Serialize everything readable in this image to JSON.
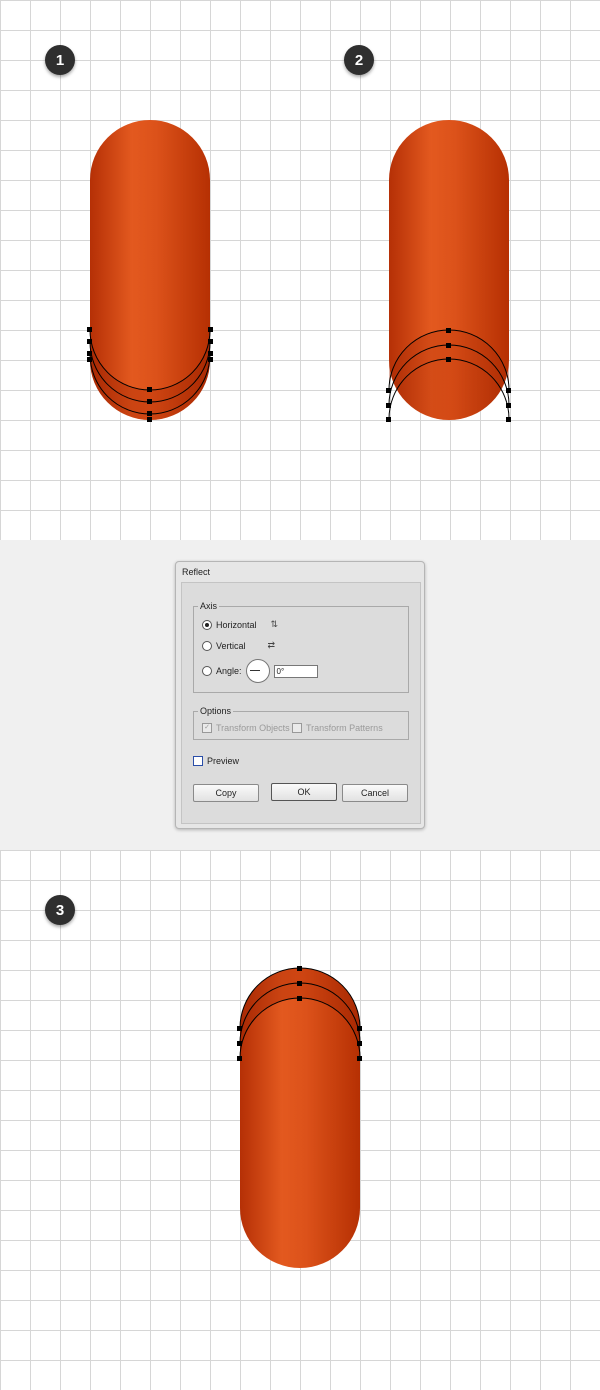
{
  "steps": {
    "s1": "1",
    "s2": "2",
    "s3": "3"
  },
  "colors": {
    "pill_dark": "#b62e03",
    "pill_light": "#e25c1f",
    "handle": "#000000",
    "step_bg": "#2f2f2f"
  },
  "dialog": {
    "title": "Reflect",
    "axis_legend": "Axis",
    "horizontal_label": "Horizontal",
    "vertical_label": "Vertical",
    "angle_label": "Angle:",
    "angle_value": "0°",
    "options_legend": "Options",
    "transform_objects_label": "Transform Objects",
    "transform_patterns_label": "Transform Patterns",
    "preview_label": "Preview",
    "copy_label": "Copy",
    "ok_label": "OK",
    "cancel_label": "Cancel",
    "selected_axis": "Horizontal"
  }
}
